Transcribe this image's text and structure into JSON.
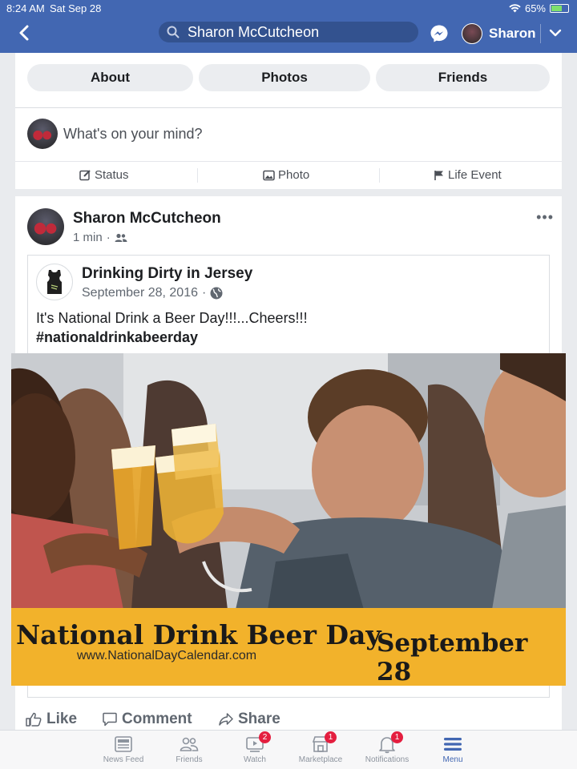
{
  "status_bar": {
    "time": "8:24 AM",
    "date": "Sat Sep 28",
    "battery": "65%",
    "battery_level": 0.65
  },
  "header": {
    "search_text": "Sharon McCutcheon",
    "user_name": "Sharon"
  },
  "profile_tabs": [
    "About",
    "Photos",
    "Friends"
  ],
  "composer": {
    "prompt": "What's on your mind?",
    "actions": [
      "Status",
      "Photo",
      "Life Event"
    ]
  },
  "post": {
    "author": "Sharon McCutcheon",
    "time": "1 min",
    "more": "•••",
    "shared": {
      "page_name": "Drinking Dirty in Jersey",
      "date": "September 28, 2016",
      "text": "It's National Drink a Beer Day!!!...Cheers!!!",
      "hashtag": "#nationaldrinkabeerday",
      "image": {
        "title": "National Drink Beer Day",
        "date": "September 28",
        "url": "www.NationalDayCalendar.com"
      }
    },
    "footer": {
      "like": "Like",
      "comment": "Comment",
      "share": "Share"
    }
  },
  "bottom_nav": [
    {
      "label": "News Feed",
      "badge": ""
    },
    {
      "label": "Friends",
      "badge": ""
    },
    {
      "label": "Watch",
      "badge": "2"
    },
    {
      "label": "Marketplace",
      "badge": "1"
    },
    {
      "label": "Notifications",
      "badge": "1"
    },
    {
      "label": "Menu",
      "badge": ""
    }
  ],
  "colors": {
    "brand": "#4267b2",
    "badge": "#e41e3f",
    "banner": "#f2b22b"
  }
}
